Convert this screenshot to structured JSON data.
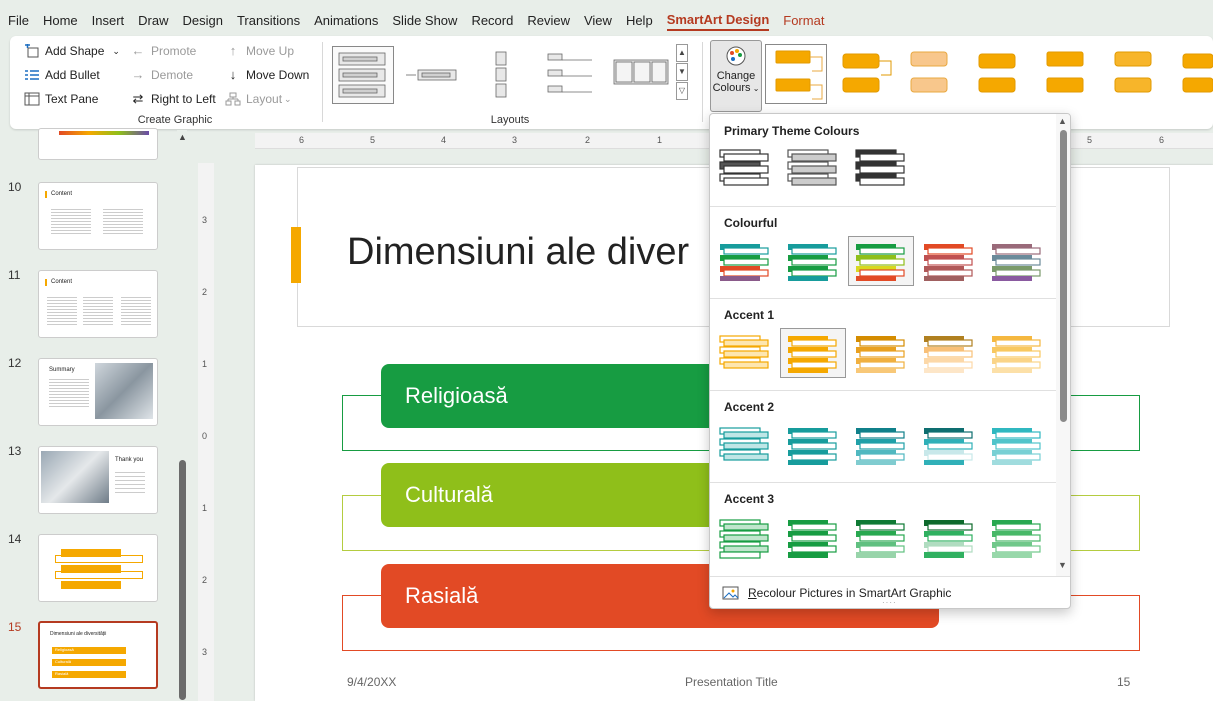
{
  "menu": [
    "File",
    "Home",
    "Insert",
    "Draw",
    "Design",
    "Transitions",
    "Animations",
    "Slide Show",
    "Record",
    "Review",
    "View",
    "Help",
    "SmartArt Design",
    "Format"
  ],
  "ribbon": {
    "add_shape": "Add Shape",
    "add_bullet": "Add Bullet",
    "text_pane": "Text Pane",
    "promote": "Promote",
    "demote": "Demote",
    "right_to_left": "Right to Left",
    "move_up": "Move Up",
    "move_down": "Move Down",
    "layout": "Layout",
    "create_graphic_label": "Create Graphic",
    "layouts_label": "Layouts",
    "change_colours_1": "Change",
    "change_colours_2": "Colours"
  },
  "rulers": {
    "h_ticks": [
      "6",
      "5",
      "4",
      "3",
      "2",
      "1",
      "5",
      "6"
    ],
    "v_ticks": [
      "3",
      "2",
      "1",
      "0",
      "1",
      "2",
      "3"
    ]
  },
  "thumbnails": {
    "numbers": [
      "10",
      "11",
      "12",
      "13",
      "14",
      "15"
    ],
    "t10": "Content",
    "t11": "Content",
    "t12": "Summary",
    "t13": "Thank you",
    "t15": "Dimensiuni ale diversității",
    "t15_items": [
      "Religioasă",
      "Culturală",
      "Rasială"
    ]
  },
  "slide": {
    "title": "Dimensiuni ale diver",
    "items": [
      "Religioasă",
      "Culturală",
      "Rasială"
    ],
    "footer_date": "9/4/20XX",
    "footer_title": "Presentation Title",
    "footer_page": "15"
  },
  "dropdown": {
    "sections": [
      "Primary Theme Colours",
      "Colourful",
      "Accent 1",
      "Accent 2",
      "Accent 3"
    ],
    "footer": "Recolour Pictures in SmartArt Graphic",
    "footer_mnemonic": "R",
    "footer_rest": "ecolour Pictures in SmartArt Graphic"
  },
  "colors": {
    "accent_orange": "#f5a800",
    "green": "#179c42",
    "lime": "#8fbf1a",
    "red": "#e24a25",
    "brand_red": "#b53a20"
  }
}
